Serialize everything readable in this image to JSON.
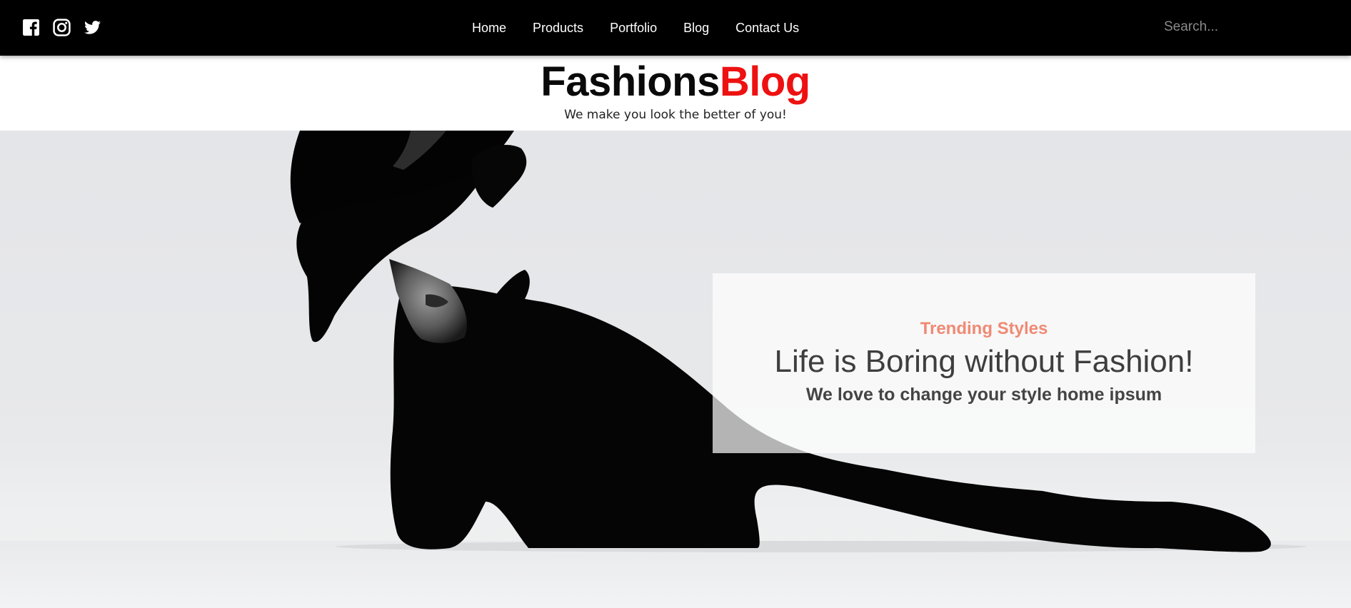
{
  "social": {
    "icons": [
      "facebook-icon",
      "instagram-icon",
      "twitter-icon"
    ]
  },
  "nav": {
    "items": [
      {
        "label": "Home"
      },
      {
        "label": "Products"
      },
      {
        "label": "Portfolio"
      },
      {
        "label": "Blog"
      },
      {
        "label": "Contact Us"
      }
    ]
  },
  "search": {
    "placeholder": "Search...",
    "value": ""
  },
  "brand": {
    "title_part1": "Fashions",
    "title_part2": "Blog",
    "tagline": "We make you look the better of you!"
  },
  "hero": {
    "image": "woman-in-black-hat-photo",
    "kicker": "Trending Styles",
    "headline": "Life is Boring without Fashion!",
    "subheadline": "We love to change your style home ipsum"
  },
  "colors": {
    "topbar": "#000000",
    "brand_dark": "#0a0a0a",
    "brand_accent": "#ee1111",
    "kicker": "#f08a73",
    "hero_bg": "#e6e7e9"
  }
}
